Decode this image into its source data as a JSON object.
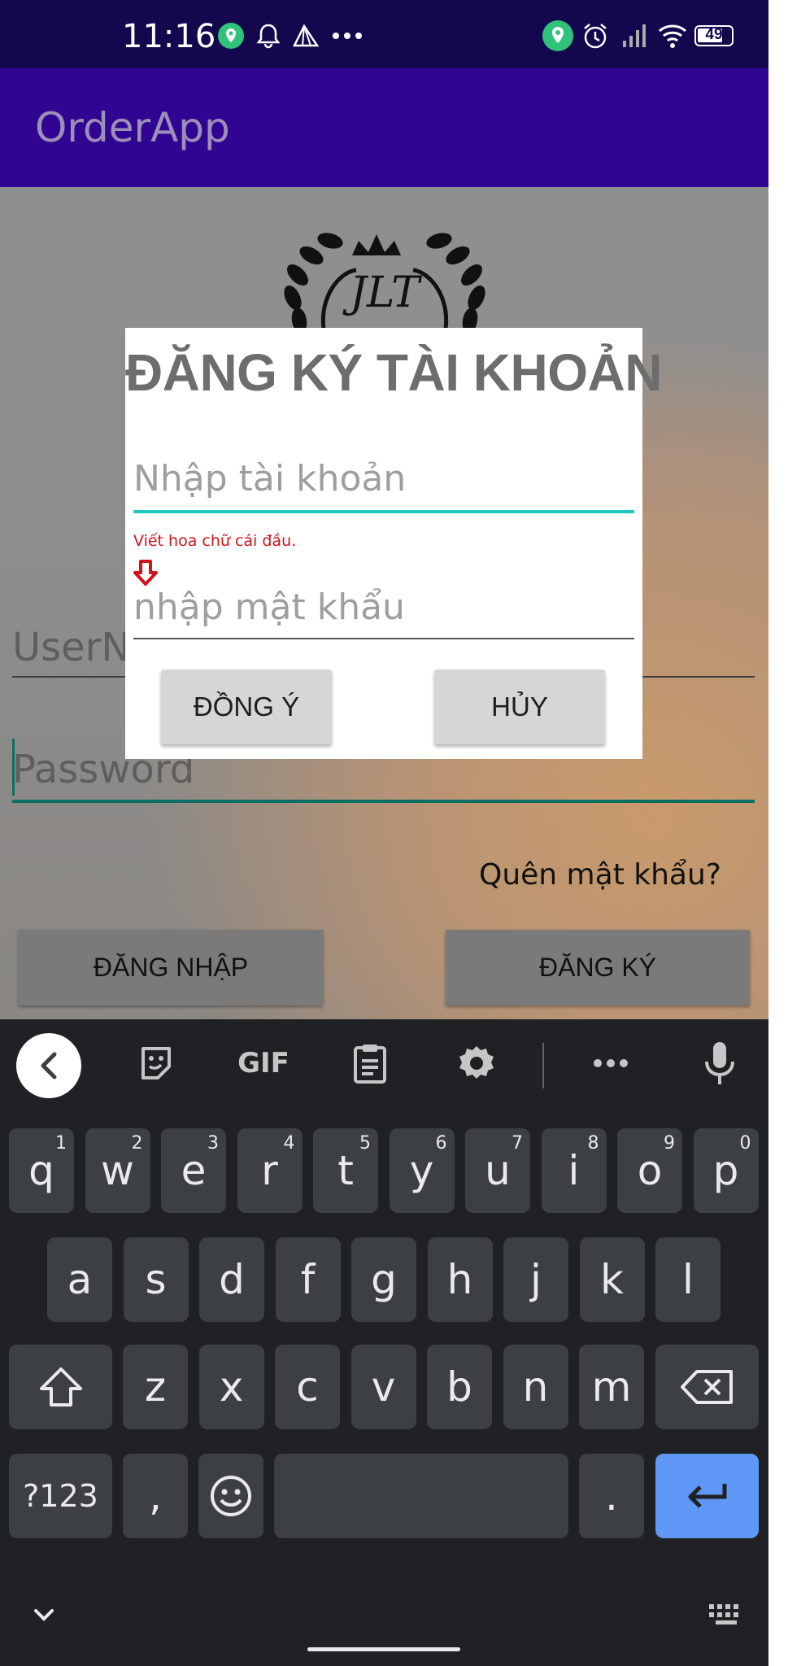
{
  "status_bar": {
    "time": "11:16",
    "battery": "49",
    "icons": [
      "location-icon",
      "bell-icon",
      "send-icon",
      "more-icon",
      "location-icon",
      "alarm-icon",
      "signal-icon",
      "wifi-icon",
      "battery-icon"
    ]
  },
  "app_bar": {
    "title": "OrderApp"
  },
  "background_form": {
    "username_placeholder": "UserName",
    "password_placeholder": "Password",
    "forgot_password": "Quên mật khẩu?",
    "login_button": "ĐĂNG NHẬP",
    "register_button": "ĐĂNG KÝ",
    "logo_text": "JLT"
  },
  "dialog": {
    "title": "ĐĂNG KÝ TÀI KHOẢN",
    "account_placeholder": "Nhập tài khoản",
    "hint": "Viết hoa chữ cái đầu.",
    "password_placeholder": "nhập mật khẩu",
    "ok_button": "ĐỒNG Ý",
    "cancel_button": "HỦY"
  },
  "keyboard": {
    "toolbar": {
      "gif_label": "GIF"
    },
    "row1": [
      {
        "k": "q",
        "s": "1"
      },
      {
        "k": "w",
        "s": "2"
      },
      {
        "k": "e",
        "s": "3"
      },
      {
        "k": "r",
        "s": "4"
      },
      {
        "k": "t",
        "s": "5"
      },
      {
        "k": "y",
        "s": "6"
      },
      {
        "k": "u",
        "s": "7"
      },
      {
        "k": "i",
        "s": "8"
      },
      {
        "k": "o",
        "s": "9"
      },
      {
        "k": "p",
        "s": "0"
      }
    ],
    "row2": [
      "a",
      "s",
      "d",
      "f",
      "g",
      "h",
      "j",
      "k",
      "l"
    ],
    "row3": [
      "z",
      "x",
      "c",
      "v",
      "b",
      "n",
      "m"
    ],
    "symbols_key": "?123",
    "comma_key": ",",
    "period_key": ".",
    "accent_color": "#5e97f6"
  }
}
